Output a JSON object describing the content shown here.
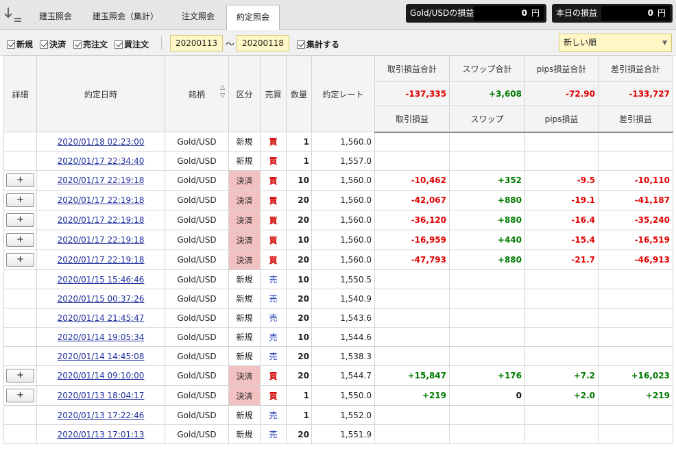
{
  "tabs": [
    {
      "label": "建玉照会",
      "active": false
    },
    {
      "label": "建玉照会（集計）",
      "active": false
    },
    {
      "label": "注文照会",
      "active": false
    },
    {
      "label": "約定照会",
      "active": true
    }
  ],
  "pl_symbol": {
    "label": "Gold/USDの損益",
    "value": "0",
    "unit": "円"
  },
  "pl_today": {
    "label": "本日の損益",
    "value": "0",
    "unit": "円"
  },
  "filters": {
    "new_label": "新規",
    "settle_label": "決済",
    "sell_order_label": "売注文",
    "buy_order_label": "買注文",
    "date_from": "20200113",
    "tilde": "〜",
    "date_to": "20200118",
    "aggregate_label": "集計する",
    "sort_value": "新しい順"
  },
  "table": {
    "headers": {
      "detail": "詳細",
      "datetime": "約定日時",
      "symbol": "銘柄",
      "category": "区分",
      "side": "売買",
      "qty": "数量",
      "rate": "約定レート",
      "trade_pl_total": "取引損益合計",
      "swap_total": "スワップ合計",
      "pips_total": "pips損益合計",
      "net_total": "差引損益合計",
      "trade_pl": "取引損益",
      "swap": "スワップ",
      "pips": "pips損益",
      "net": "差引損益"
    },
    "totals": {
      "trade_pl": "-137,335",
      "swap": "+3,608",
      "pips": "-72.90",
      "net": "-133,727"
    },
    "rows": [
      {
        "datetime": "2020/01/18 02:23:00",
        "symbol": "Gold/USD",
        "category": "新規",
        "side": "買",
        "qty": "1",
        "rate": "1,560.0",
        "trade_pl": "",
        "swap": "",
        "pips": "",
        "net": ""
      },
      {
        "datetime": "2020/01/17 22:34:40",
        "symbol": "Gold/USD",
        "category": "新規",
        "side": "買",
        "qty": "1",
        "rate": "1,557.0",
        "trade_pl": "",
        "swap": "",
        "pips": "",
        "net": ""
      },
      {
        "datetime": "2020/01/17 22:19:18",
        "symbol": "Gold/USD",
        "category": "決済",
        "side": "買",
        "qty": "10",
        "rate": "1,560.0",
        "trade_pl": "-10,462",
        "swap": "+352",
        "pips": "-9.5",
        "net": "-10,110",
        "button": "+"
      },
      {
        "datetime": "2020/01/17 22:19:18",
        "symbol": "Gold/USD",
        "category": "決済",
        "side": "買",
        "qty": "20",
        "rate": "1,560.0",
        "trade_pl": "-42,067",
        "swap": "+880",
        "pips": "-19.1",
        "net": "-41,187",
        "button": "+"
      },
      {
        "datetime": "2020/01/17 22:19:18",
        "symbol": "Gold/USD",
        "category": "決済",
        "side": "買",
        "qty": "20",
        "rate": "1,560.0",
        "trade_pl": "-36,120",
        "swap": "+880",
        "pips": "-16.4",
        "net": "-35,240",
        "button": "+"
      },
      {
        "datetime": "2020/01/17 22:19:18",
        "symbol": "Gold/USD",
        "category": "決済",
        "side": "買",
        "qty": "10",
        "rate": "1,560.0",
        "trade_pl": "-16,959",
        "swap": "+440",
        "pips": "-15.4",
        "net": "-16,519",
        "button": "+"
      },
      {
        "datetime": "2020/01/17 22:19:18",
        "symbol": "Gold/USD",
        "category": "決済",
        "side": "買",
        "qty": "20",
        "rate": "1,560.0",
        "trade_pl": "-47,793",
        "swap": "+880",
        "pips": "-21.7",
        "net": "-46,913",
        "button": "+"
      },
      {
        "datetime": "2020/01/15 15:46:46",
        "symbol": "Gold/USD",
        "category": "新規",
        "side": "売",
        "qty": "10",
        "rate": "1,550.5",
        "trade_pl": "",
        "swap": "",
        "pips": "",
        "net": ""
      },
      {
        "datetime": "2020/01/15 00:37:26",
        "symbol": "Gold/USD",
        "category": "新規",
        "side": "売",
        "qty": "20",
        "rate": "1,540.9",
        "trade_pl": "",
        "swap": "",
        "pips": "",
        "net": ""
      },
      {
        "datetime": "2020/01/14 21:45:47",
        "symbol": "Gold/USD",
        "category": "新規",
        "side": "売",
        "qty": "20",
        "rate": "1,543.6",
        "trade_pl": "",
        "swap": "",
        "pips": "",
        "net": ""
      },
      {
        "datetime": "2020/01/14 19:05:34",
        "symbol": "Gold/USD",
        "category": "新規",
        "side": "売",
        "qty": "10",
        "rate": "1,544.6",
        "trade_pl": "",
        "swap": "",
        "pips": "",
        "net": ""
      },
      {
        "datetime": "2020/01/14 14:45:08",
        "symbol": "Gold/USD",
        "category": "新規",
        "side": "売",
        "qty": "20",
        "rate": "1,538.3",
        "trade_pl": "",
        "swap": "",
        "pips": "",
        "net": ""
      },
      {
        "datetime": "2020/01/14 09:10:00",
        "symbol": "Gold/USD",
        "category": "決済",
        "side": "買",
        "qty": "20",
        "rate": "1,544.7",
        "trade_pl": "+15,847",
        "swap": "+176",
        "pips": "+7.2",
        "net": "+16,023",
        "button": "+"
      },
      {
        "datetime": "2020/01/13 18:04:17",
        "symbol": "Gold/USD",
        "category": "決済",
        "side": "買",
        "qty": "1",
        "rate": "1,550.0",
        "trade_pl": "+219",
        "swap": "0",
        "pips": "+2.0",
        "net": "+219",
        "button": "+"
      },
      {
        "datetime": "2020/01/13 17:22:46",
        "symbol": "Gold/USD",
        "category": "新規",
        "side": "売",
        "qty": "1",
        "rate": "1,552.0",
        "trade_pl": "",
        "swap": "",
        "pips": "",
        "net": ""
      },
      {
        "datetime": "2020/01/13 17:01:13",
        "symbol": "Gold/USD",
        "category": "新規",
        "side": "売",
        "qty": "20",
        "rate": "1,551.9",
        "trade_pl": "",
        "swap": "",
        "pips": "",
        "net": ""
      }
    ]
  },
  "colors": {
    "loss": "#e00000",
    "profit": "#007a00",
    "buy": "#d40000",
    "sell": "#1a35b3",
    "settle_bg": "#f2c1c1",
    "input_bg": "#fff8c6",
    "link": "#1f2f9e"
  },
  "icons": {
    "sort": "sort-down-icon",
    "sort_arrows": "sort-toggle-icon",
    "dropdown": "chevron-down-icon"
  }
}
